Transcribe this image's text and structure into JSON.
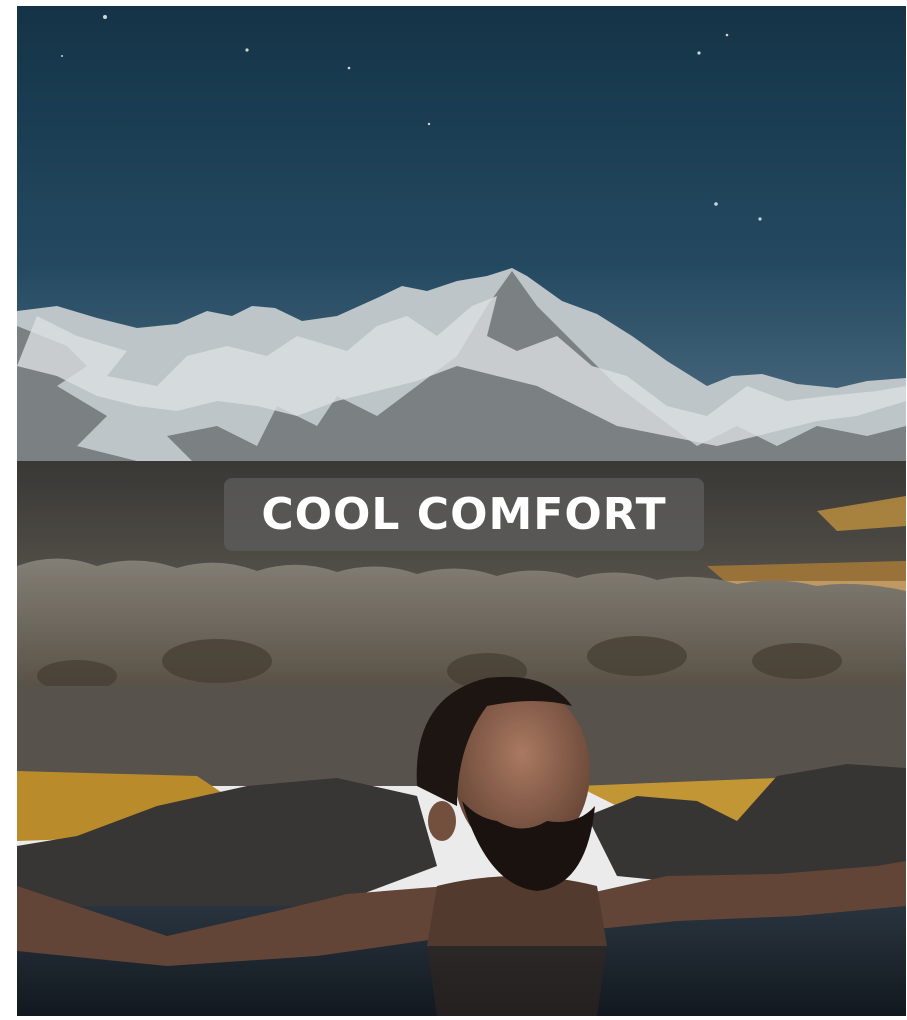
{
  "caption": {
    "text": "COOL COMFORT"
  },
  "photo": {
    "subject": "man-in-hot-spring",
    "sky_color": "#1f4258",
    "snow_color": "#e8ecee",
    "sand_color": "#d3a33a"
  }
}
